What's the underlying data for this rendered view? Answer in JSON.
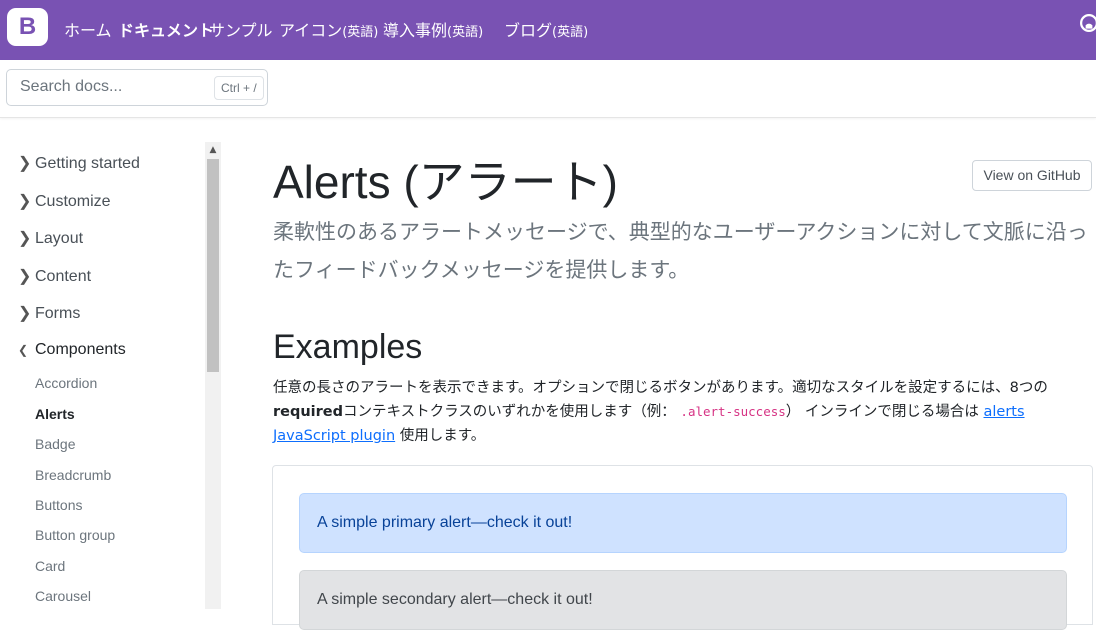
{
  "navbar": {
    "brand": "B",
    "links": [
      {
        "label": "ホーム",
        "suffix": ""
      },
      {
        "label": "ドキュメント",
        "suffix": ""
      },
      {
        "label": "サンプル",
        "suffix": ""
      },
      {
        "label": "アイコン",
        "suffix": "(英語)"
      },
      {
        "label": "導入事例",
        "suffix": "(英語)"
      },
      {
        "label": "ブログ",
        "suffix": "(英語)"
      }
    ],
    "github_icon": "github-icon",
    "brand_color": "#7952b3"
  },
  "search": {
    "placeholder": "Search docs...",
    "shortcut": "Ctrl + /"
  },
  "sidebar": {
    "groups": [
      {
        "label": "Getting started",
        "icon": "chevron-right"
      },
      {
        "label": "Customize",
        "icon": "chevron-right"
      },
      {
        "label": "Layout",
        "icon": "chevron-right"
      },
      {
        "label": "Content",
        "icon": "chevron-right"
      },
      {
        "label": "Forms",
        "icon": "chevron-right"
      },
      {
        "label": "Components",
        "icon": "chevron-down"
      }
    ],
    "items": [
      {
        "label": "Accordion"
      },
      {
        "label": "Alerts",
        "active": true
      },
      {
        "label": "Badge"
      },
      {
        "label": "Breadcrumb"
      },
      {
        "label": "Buttons"
      },
      {
        "label": "Button group"
      },
      {
        "label": "Card"
      },
      {
        "label": "Carousel"
      }
    ]
  },
  "main": {
    "title": "Alerts (アラート)",
    "github_button": "View on GitHub",
    "lead": "柔軟性のあるアラートメッセージで、典型的なユーザーアクションに対して文脈に沿ったフィードバックメッセージを提供します。",
    "section_heading": "Examples",
    "section_text": {
      "part1": "任意の長さのアラートを表示できます。オプションで閉じるボタンがあります。適切なスタイルを設定するには、8つの",
      "bold": "required",
      "part2": "コンテキストクラスのいずれかを使用します（例：",
      "code": ".alert-success",
      "part3": "） インラインで閉じる場合は",
      "link": "alerts JavaScript plugin",
      "part4": "使用します。"
    },
    "alerts": [
      {
        "text": "A simple primary alert—check it out!",
        "variant": "primary",
        "color": "#cfe2ff"
      },
      {
        "text": "A simple secondary alert—check it out!",
        "variant": "secondary",
        "color": "#e2e3e5"
      }
    ]
  }
}
